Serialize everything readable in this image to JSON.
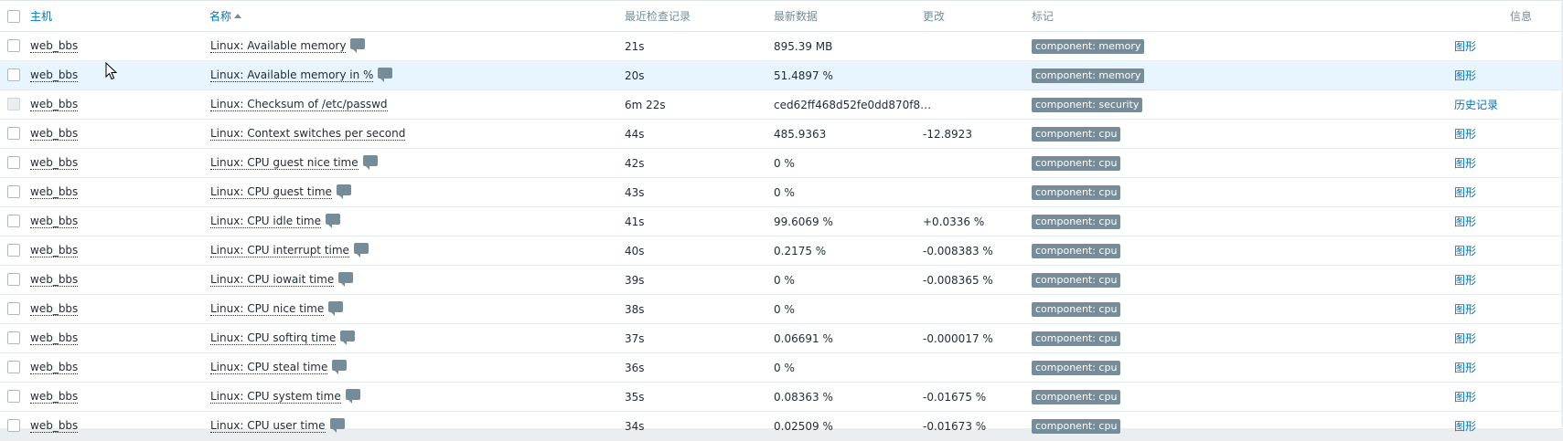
{
  "header": {
    "host": "主机",
    "name": "名称",
    "last_check": "最近检查记录",
    "latest_data": "最新数据",
    "change": "更改",
    "tags": "标记",
    "info": "信息"
  },
  "rows": [
    {
      "host": "web_bbs",
      "name": "Linux: Available memory",
      "hint": true,
      "last_check": "21s",
      "value": "895.39 MB",
      "change": "",
      "tag": "component: memory",
      "action": "图形",
      "disabled": false,
      "highlight": false
    },
    {
      "host": "web_bbs",
      "name": "Linux: Available memory in %",
      "hint": true,
      "last_check": "20s",
      "value": "51.4897 %",
      "change": "",
      "tag": "component: memory",
      "action": "图形",
      "disabled": false,
      "highlight": true
    },
    {
      "host": "web_bbs",
      "name": "Linux: Checksum of /etc/passwd",
      "hint": false,
      "last_check": "6m 22s",
      "value": "ced62ff468d52fe0dd870f8…",
      "change": "",
      "tag": "component: security",
      "action": "历史记录",
      "disabled": true,
      "highlight": false
    },
    {
      "host": "web_bbs",
      "name": "Linux: Context switches per second",
      "hint": false,
      "last_check": "44s",
      "value": "485.9363",
      "change": "-12.8923",
      "tag": "component: cpu",
      "action": "图形",
      "disabled": false,
      "highlight": false
    },
    {
      "host": "web_bbs",
      "name": "Linux: CPU guest nice time",
      "hint": true,
      "last_check": "42s",
      "value": "0 %",
      "change": "",
      "tag": "component: cpu",
      "action": "图形",
      "disabled": false,
      "highlight": false
    },
    {
      "host": "web_bbs",
      "name": "Linux: CPU guest time",
      "hint": true,
      "last_check": "43s",
      "value": "0 %",
      "change": "",
      "tag": "component: cpu",
      "action": "图形",
      "disabled": false,
      "highlight": false
    },
    {
      "host": "web_bbs",
      "name": "Linux: CPU idle time",
      "hint": true,
      "last_check": "41s",
      "value": "99.6069 %",
      "change": "+0.0336 %",
      "tag": "component: cpu",
      "action": "图形",
      "disabled": false,
      "highlight": false
    },
    {
      "host": "web_bbs",
      "name": "Linux: CPU interrupt time",
      "hint": true,
      "last_check": "40s",
      "value": "0.2175 %",
      "change": "-0.008383 %",
      "tag": "component: cpu",
      "action": "图形",
      "disabled": false,
      "highlight": false
    },
    {
      "host": "web_bbs",
      "name": "Linux: CPU iowait time",
      "hint": true,
      "last_check": "39s",
      "value": "0 %",
      "change": "-0.008365 %",
      "tag": "component: cpu",
      "action": "图形",
      "disabled": false,
      "highlight": false
    },
    {
      "host": "web_bbs",
      "name": "Linux: CPU nice time",
      "hint": true,
      "last_check": "38s",
      "value": "0 %",
      "change": "",
      "tag": "component: cpu",
      "action": "图形",
      "disabled": false,
      "highlight": false
    },
    {
      "host": "web_bbs",
      "name": "Linux: CPU softirq time",
      "hint": true,
      "last_check": "37s",
      "value": "0.06691 %",
      "change": "-0.000017 %",
      "tag": "component: cpu",
      "action": "图形",
      "disabled": false,
      "highlight": false
    },
    {
      "host": "web_bbs",
      "name": "Linux: CPU steal time",
      "hint": true,
      "last_check": "36s",
      "value": "0 %",
      "change": "",
      "tag": "component: cpu",
      "action": "图形",
      "disabled": false,
      "highlight": false
    },
    {
      "host": "web_bbs",
      "name": "Linux: CPU system time",
      "hint": true,
      "last_check": "35s",
      "value": "0.08363 %",
      "change": "-0.01675 %",
      "tag": "component: cpu",
      "action": "图形",
      "disabled": false,
      "highlight": false
    },
    {
      "host": "web_bbs",
      "name": "Linux: CPU user time",
      "hint": true,
      "last_check": "34s",
      "value": "0.02509 %",
      "change": "-0.01673 %",
      "tag": "component: cpu",
      "action": "图形",
      "disabled": false,
      "highlight": false
    }
  ]
}
